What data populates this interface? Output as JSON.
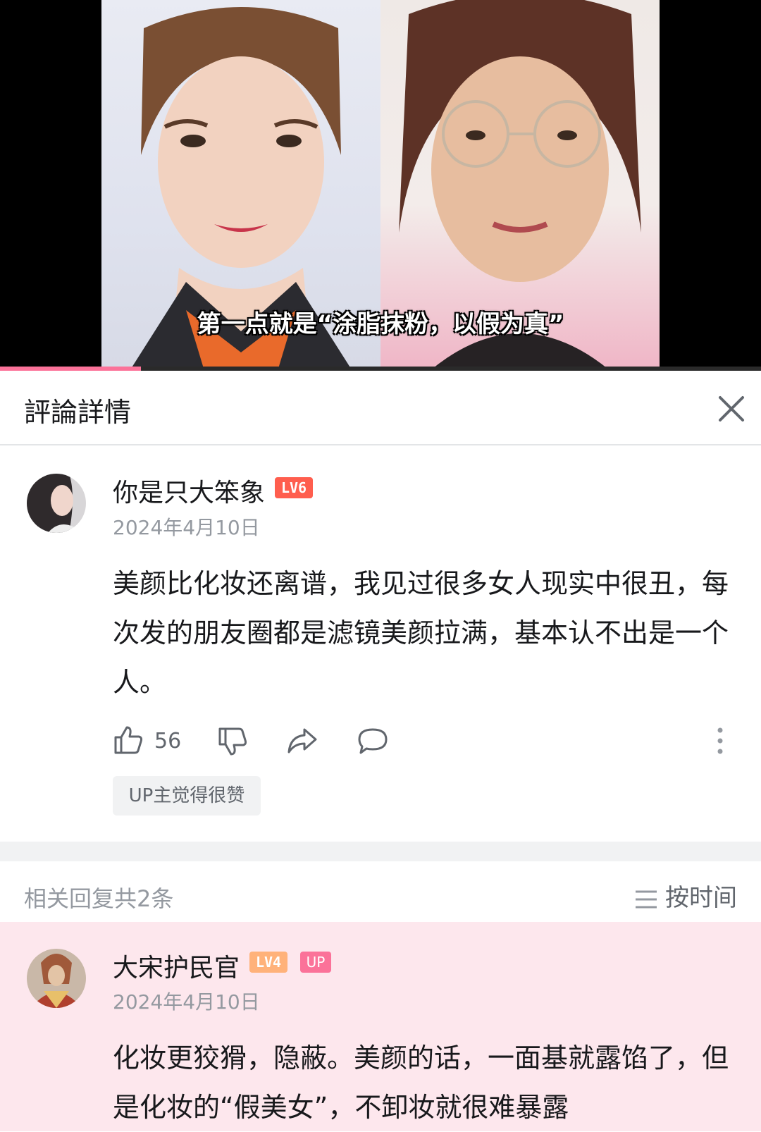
{
  "video": {
    "subtitle": "第一点就是“涂脂抹粉，以假为真”",
    "progress_fraction": 0.185
  },
  "header": {
    "title": "評論詳情"
  },
  "main_comment": {
    "username": "你是只大笨象",
    "level": "LV6",
    "date": "2024年4月10日",
    "text": "美颜比化妆还离谱，我见过很多女人现实中很丑，每次发的朋友圈都是滤镜美颜拉满，基本认不出是一个人。",
    "likes": "56",
    "up_tag": "UP主觉得很赞"
  },
  "replies_bar": {
    "count_label": "相关回复共2条",
    "sort_label": "按时间"
  },
  "reply": {
    "username": "大宋护民官",
    "level": "LV4",
    "up_badge": "UP",
    "date": "2024年4月10日",
    "text": "化妆更狡猾，隐蔽。美颜的话，一面基就露馅了，但是化妆的“假美女”，不卸妆就很难暴露"
  },
  "colors": {
    "accent_pink": "#fb7299",
    "lv6": "#ff5e4e",
    "lv4": "#ffb27a",
    "reply_highlight_bg": "#fde7ed"
  }
}
